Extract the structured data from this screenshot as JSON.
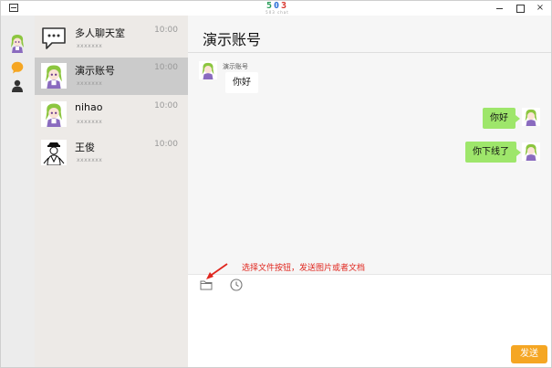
{
  "app": {
    "logo": {
      "digits": [
        "5",
        "0",
        "3"
      ],
      "subtitle": "503 chat"
    },
    "window_controls": {
      "minimize": "",
      "maximize": "",
      "close": "×"
    }
  },
  "rail": {
    "items": [
      {
        "name": "avatar",
        "icon": "anime-avatar"
      },
      {
        "name": "chat",
        "icon": "chat-bubble-icon",
        "color": "#f5a623"
      },
      {
        "name": "contacts",
        "icon": "person-icon"
      }
    ]
  },
  "conversations": [
    {
      "name": "多人聊天室",
      "time": "10:00",
      "preview": "xxxxxxx",
      "avatar": "chat-bubble-icon",
      "active": false
    },
    {
      "name": "演示账号",
      "time": "10:00",
      "preview": "xxxxxxx",
      "avatar": "anime-avatar",
      "active": true
    },
    {
      "name": "nihao",
      "time": "10:00",
      "preview": "xxxxxxx",
      "avatar": "anime-avatar",
      "active": false
    },
    {
      "name": "王俊",
      "time": "10:00",
      "preview": "xxxxxxx",
      "avatar": "sketch-avatar",
      "active": false
    }
  ],
  "chat": {
    "title": "演示账号",
    "messages": [
      {
        "direction": "in",
        "sender": "演示账号",
        "text": "你好"
      },
      {
        "direction": "out",
        "text": "你好"
      },
      {
        "direction": "out",
        "text": "你下线了"
      }
    ]
  },
  "annotation": {
    "text": "选择文件按钮，发送图片或者文档",
    "color": "#e0261e"
  },
  "input": {
    "tools": [
      {
        "name": "folder-icon"
      },
      {
        "name": "clock-icon"
      }
    ],
    "send_label": "发送",
    "send_color": "#f5a623",
    "out_bubble_color": "#9ee66b"
  }
}
